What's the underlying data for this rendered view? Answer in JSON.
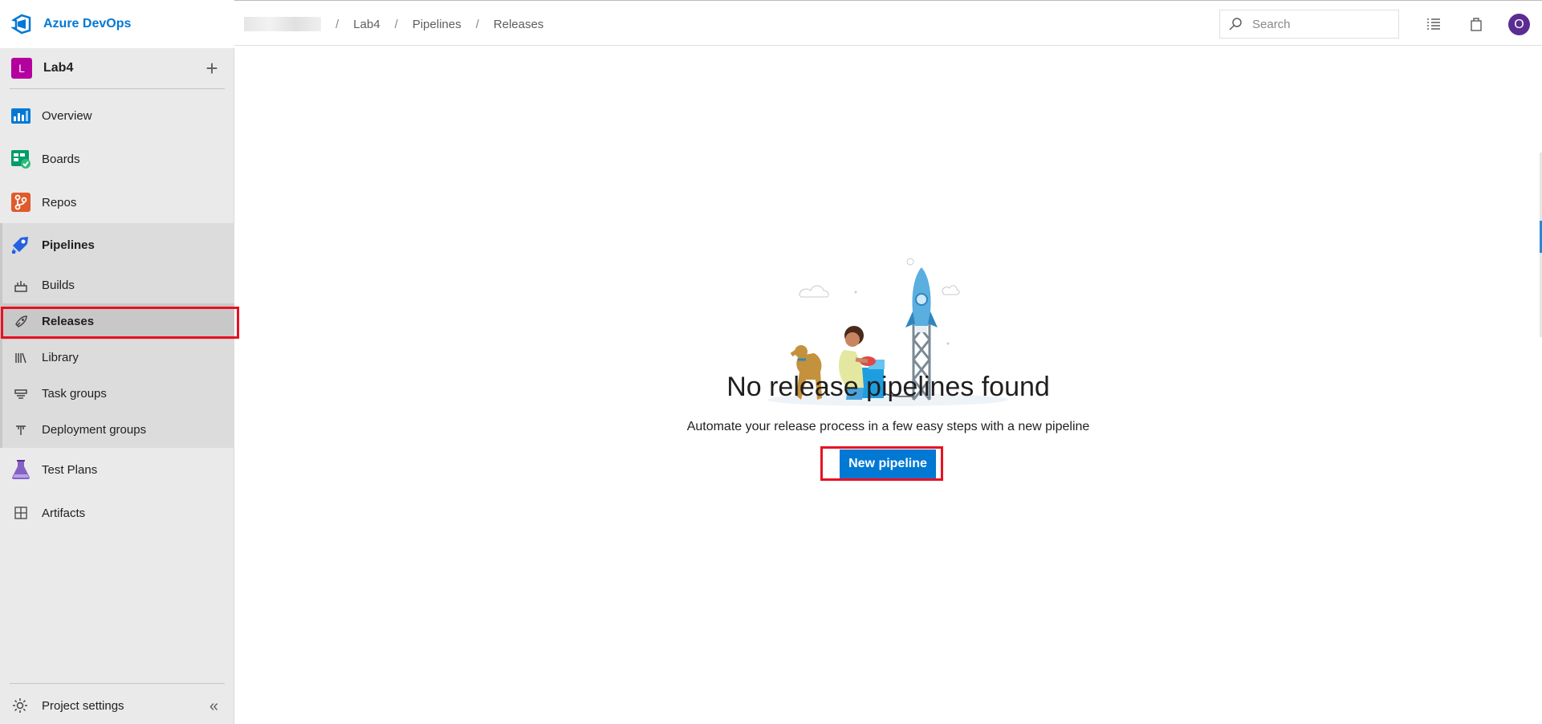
{
  "app": {
    "brand": "Azure DevOps"
  },
  "project": {
    "initial": "L",
    "name": "Lab4",
    "badge_color": "#b4009e"
  },
  "sidebar": {
    "items": [
      {
        "label": "Overview",
        "icon": "overview-icon"
      },
      {
        "label": "Boards",
        "icon": "boards-icon"
      },
      {
        "label": "Repos",
        "icon": "repos-icon"
      },
      {
        "label": "Pipelines",
        "icon": "pipelines-icon"
      },
      {
        "label": "Test Plans",
        "icon": "test-plans-icon"
      },
      {
        "label": "Artifacts",
        "icon": "artifacts-icon"
      }
    ],
    "pipelines_sub": [
      {
        "label": "Builds",
        "icon": "builds-icon"
      },
      {
        "label": "Releases",
        "icon": "rocket-icon",
        "selected": true
      },
      {
        "label": "Library",
        "icon": "library-icon"
      },
      {
        "label": "Task groups",
        "icon": "task-groups-icon"
      },
      {
        "label": "Deployment groups",
        "icon": "deployment-groups-icon"
      }
    ],
    "settings_label": "Project settings"
  },
  "breadcrumb": {
    "items": [
      "Lab4",
      "Pipelines",
      "Releases"
    ],
    "separator": "/"
  },
  "search": {
    "placeholder": "Search"
  },
  "user": {
    "initial": "O",
    "avatar_color": "#5c2d91"
  },
  "empty_state": {
    "title": "No release pipelines found",
    "subtitle": "Automate your release process in a few easy steps with a new pipeline",
    "button_label": "New pipeline"
  },
  "colors": {
    "accent": "#0078d4",
    "highlight": "#e81123"
  }
}
